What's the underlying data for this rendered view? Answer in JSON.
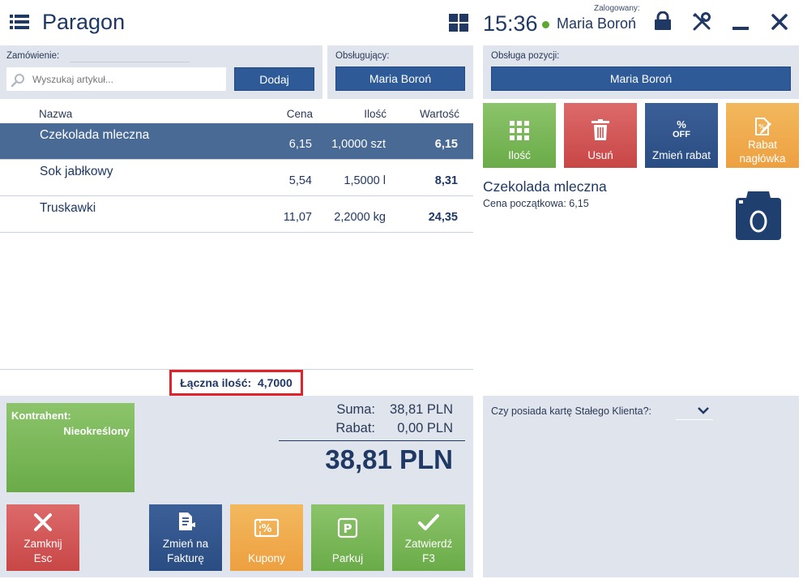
{
  "header": {
    "title": "Paragon",
    "clock": "15:36",
    "logged_label": "Zalogowany:",
    "user": "Maria Boroń"
  },
  "order": {
    "label": "Zamówienie:",
    "search_placeholder": "Wyszukaj artykuł...",
    "add_label": "Dodaj"
  },
  "serving": {
    "label": "Obsługujący:",
    "value": "Maria Boroń"
  },
  "position": {
    "label": "Obsługa pozycji:",
    "value": "Maria Boroń"
  },
  "table": {
    "headers": {
      "name": "Nazwa",
      "price": "Cena",
      "qty": "Ilość",
      "value": "Wartość"
    },
    "rows": [
      {
        "name": "Czekolada mleczna",
        "price": "6,15",
        "qty": "1,0000 szt",
        "value": "6,15",
        "selected": true
      },
      {
        "name": "Sok jabłkowy",
        "price": "5,54",
        "qty": "1,5000 l",
        "value": "8,31",
        "selected": false
      },
      {
        "name": "Truskawki",
        "price": "11,07",
        "qty": "2,2000 kg",
        "value": "24,35",
        "selected": false
      }
    ],
    "total_label": "Łączna ilość:",
    "total_value": "4,7000"
  },
  "contractor": {
    "label": "Kontrahent:",
    "value": "Nieokreślony"
  },
  "summary": {
    "sum_label": "Suma:",
    "sum_value": "38,81 PLN",
    "discount_label": "Rabat:",
    "discount_value": "0,00 PLN",
    "total": "38,81 PLN"
  },
  "actions": {
    "close": [
      "Zamknij",
      "Esc"
    ],
    "invoice": [
      "Zmień na",
      "Fakturę"
    ],
    "coupons": "Kupony",
    "park": "Parkuj",
    "confirm": [
      "Zatwierdź",
      "F3"
    ]
  },
  "position_tiles": {
    "qty": "Ilość",
    "delete": "Usuń",
    "change_discount": "Zmień rabat",
    "header_discount": [
      "Rabat",
      "nagłówka"
    ],
    "off_text": "OFF"
  },
  "item_details": {
    "name": "Czekolada mleczna",
    "price_label": "Cena początkowa: 6,15"
  },
  "loyalty": {
    "question": "Czy posiada kartę Stałego Klienta?:"
  },
  "colors": {
    "navy": "#1f3864",
    "accent": "#2e5b98",
    "selected_row": "#4a6a96",
    "green": "#6aab48",
    "red": "#c84646",
    "orange": "#eda040",
    "highlight": "#e0222a"
  }
}
